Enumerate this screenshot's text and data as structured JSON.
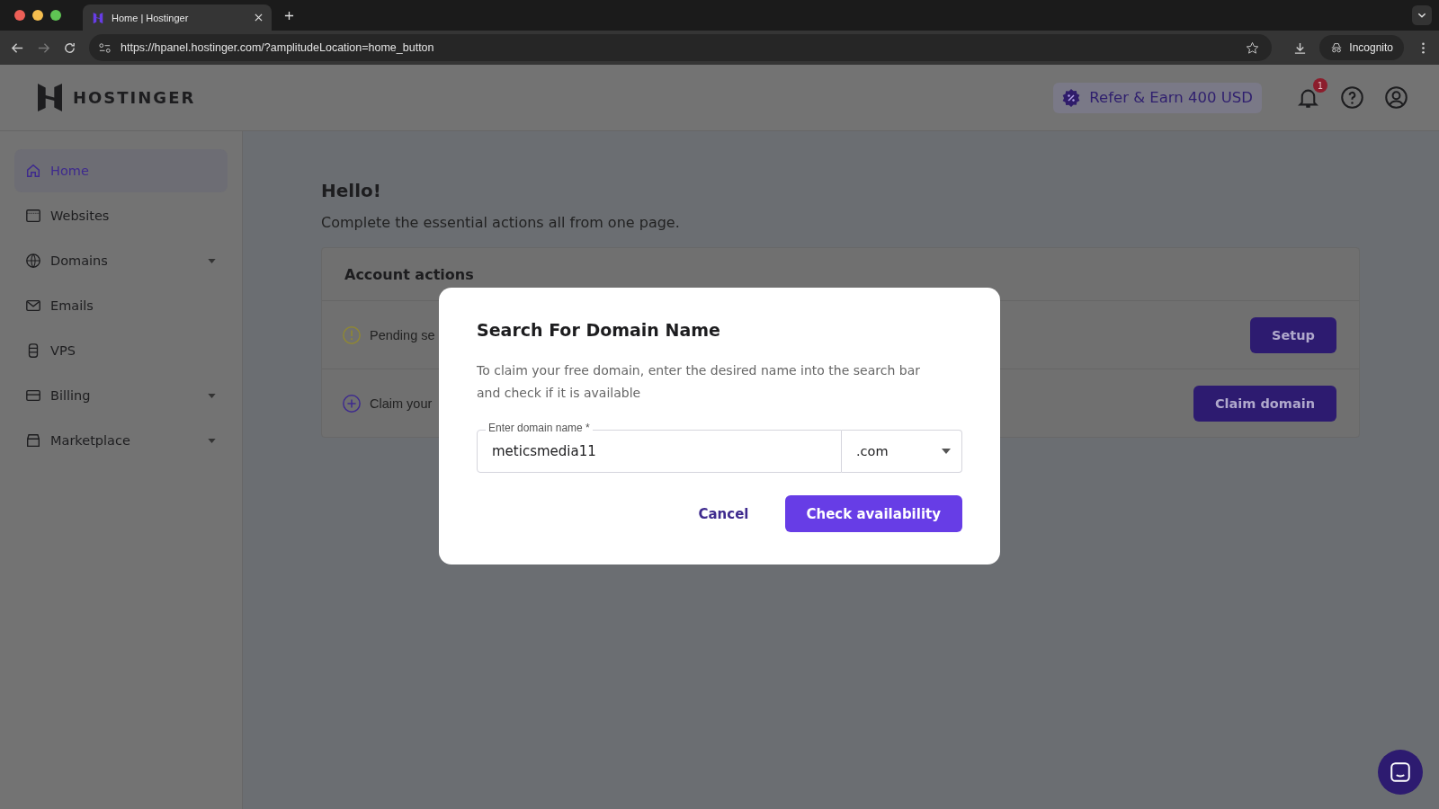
{
  "browser": {
    "tab_title": "Home | Hostinger",
    "url": "https://hpanel.hostinger.com/?amplitudeLocation=home_button",
    "profile": "Incognito"
  },
  "header": {
    "logo": "HOSTINGER",
    "refer_button": "Refer & Earn 400 USD",
    "notification_count": "1"
  },
  "sidebar": {
    "items": [
      {
        "label": "Home",
        "selected": true,
        "has_submenu": false
      },
      {
        "label": "Websites",
        "selected": false,
        "has_submenu": false
      },
      {
        "label": "Domains",
        "selected": false,
        "has_submenu": true
      },
      {
        "label": "Emails",
        "selected": false,
        "has_submenu": false
      },
      {
        "label": "VPS",
        "selected": false,
        "has_submenu": false
      },
      {
        "label": "Billing",
        "selected": false,
        "has_submenu": true
      },
      {
        "label": "Marketplace",
        "selected": false,
        "has_submenu": true
      }
    ]
  },
  "main": {
    "title": "Hello!",
    "subtitle": "Complete the essential actions all from one page.",
    "account_actions": {
      "title": "Account actions",
      "rows": [
        {
          "kind": "warning",
          "text": "Pending se",
          "button": "Setup"
        },
        {
          "kind": "add",
          "text": "Claim your",
          "button": "Claim domain"
        }
      ]
    }
  },
  "dialog": {
    "title": "Search For Domain Name",
    "description": "To claim your free domain, enter the desired name into the search bar and check if it is available",
    "field_label": "Enter domain name *",
    "field_value": "meticsmedia11",
    "tld": ".com",
    "cancel": "Cancel",
    "confirm": "Check availability"
  }
}
